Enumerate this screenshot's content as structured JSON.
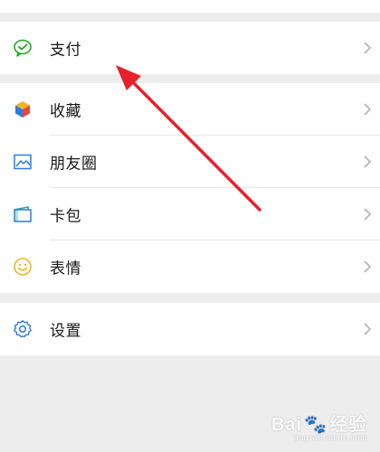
{
  "sections": [
    {
      "items": [
        {
          "label": "支付",
          "icon": "wechat-pay-icon"
        }
      ]
    },
    {
      "items": [
        {
          "label": "收藏",
          "icon": "favorites-cube-icon"
        },
        {
          "label": "朋友圈",
          "icon": "moments-image-icon"
        },
        {
          "label": "卡包",
          "icon": "card-wallet-icon"
        },
        {
          "label": "表情",
          "icon": "emoji-smile-icon"
        }
      ]
    },
    {
      "items": [
        {
          "label": "设置",
          "icon": "settings-gear-icon"
        }
      ]
    }
  ],
  "watermark": {
    "brand": "Bai",
    "brand2": "经验",
    "sub": "jingyan.baidu.com"
  },
  "colors": {
    "background": "#ededed",
    "arrow": "#e8202e",
    "pay_green": "#1aad19",
    "settings_blue": "#2c7be5"
  }
}
